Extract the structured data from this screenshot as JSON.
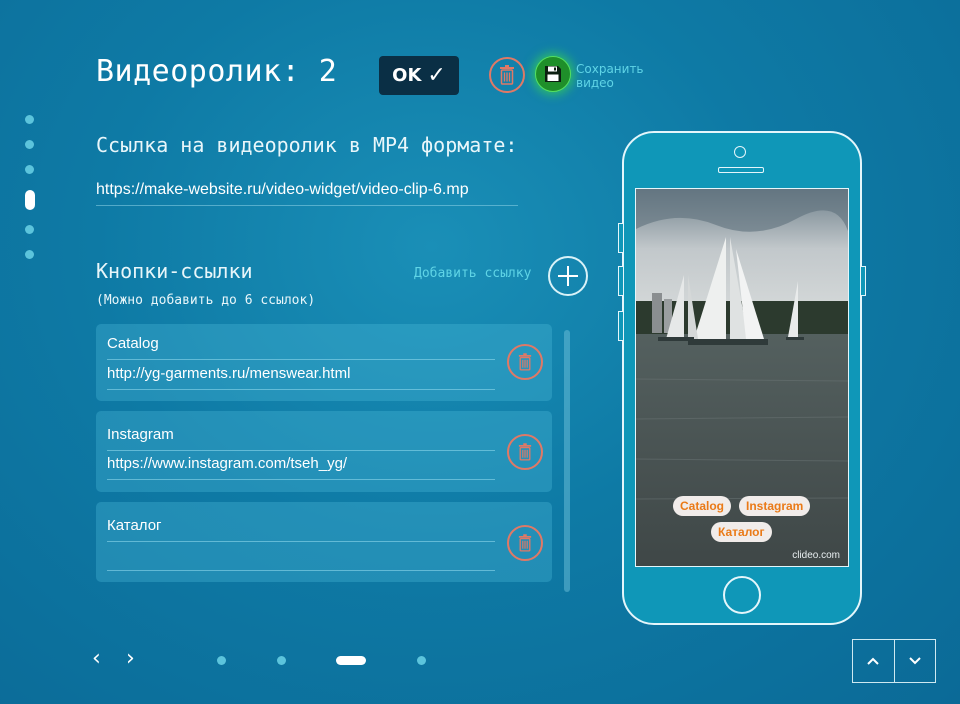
{
  "header": {
    "title": "Видеоролик: 2",
    "ok_label": "OK",
    "ok_check": "✓",
    "save_label_line1": "Сохранить",
    "save_label_line2": "видео"
  },
  "video": {
    "url_label": "Ссылка на видеоролик в MP4 формате:",
    "url_value": "https://make-website.ru/video-widget/video-clip-6.mp"
  },
  "links": {
    "title": "Кнопки-ссылки",
    "note": "(Можно добавить до 6 ссылок)",
    "add_label": "Добавить ссылку",
    "items": [
      {
        "name": "Catalog",
        "url": "http://yg-garments.ru/menswear.html"
      },
      {
        "name": "Instagram",
        "url": "https://www.instagram.com/tseh_yg/"
      },
      {
        "name": "Каталог",
        "url": ""
      }
    ]
  },
  "preview": {
    "chips": [
      "Catalog",
      "Instagram",
      "Каталог"
    ],
    "watermark": "clideo.com"
  },
  "nav": {
    "prev": "‹",
    "next": "›"
  },
  "colors": {
    "accent": "#5fd4e6",
    "delete": "#e07966",
    "save": "#1f8f2a",
    "chip_text": "#ea7a17"
  },
  "icons": [
    "trash-icon",
    "floppy-disk-icon",
    "plus-icon",
    "chevron-up-icon",
    "chevron-down-icon",
    "check-icon"
  ]
}
